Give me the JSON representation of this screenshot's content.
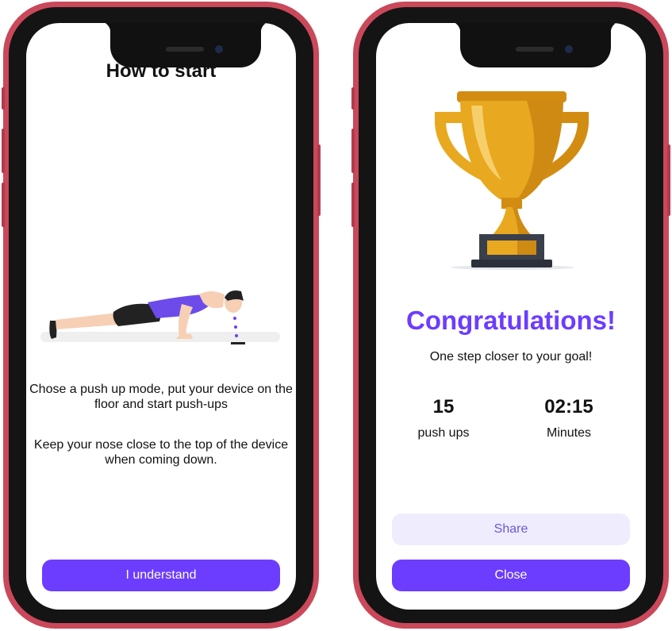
{
  "screen_left": {
    "title": "How to start",
    "instruction_1": "Chose a push up mode, put your device on  the floor and start push-ups",
    "instruction_2": "Keep your nose close to the top of the device\nwhen coming down.",
    "understand_button": "I understand"
  },
  "screen_right": {
    "congrats": "Congratulations!",
    "subtitle": "One step closer to your goal!",
    "stats": [
      {
        "value": "15",
        "label": "push ups"
      },
      {
        "value": "02:15",
        "label": "Minutes"
      }
    ],
    "share_button": "Share",
    "close_button": "Close"
  },
  "colors": {
    "accent": "#6c3dff",
    "secondary_button_bg": "#efecfd",
    "phone_frame": "#c9485a",
    "trophy_gold": "#e8a81f"
  }
}
